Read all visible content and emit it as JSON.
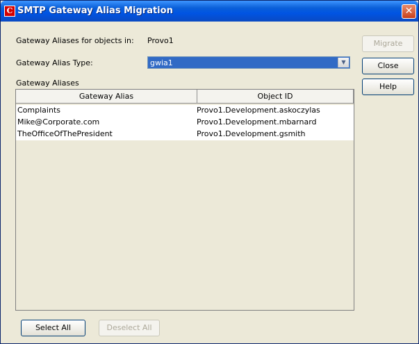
{
  "window": {
    "title": "SMTP Gateway Alias Migration"
  },
  "form": {
    "objects_label": "Gateway Aliases for objects in:",
    "objects_value": "Provo1",
    "type_label": "Gateway Alias Type:",
    "type_value": "gwia1",
    "list_label": "Gateway Aliases"
  },
  "table": {
    "columns": [
      "Gateway Alias",
      "Object ID"
    ],
    "rows": [
      [
        "Complaints",
        "Provo1.Development.askoczylas"
      ],
      [
        "Mike@Corporate.com",
        "Provo1.Development.mbarnard"
      ],
      [
        "TheOfficeOfThePresident",
        "Provo1.Development.gsmith"
      ]
    ]
  },
  "buttons": {
    "migrate": "Migrate",
    "close": "Close",
    "help": "Help",
    "select_all": "Select All",
    "deselect_all": "Deselect All"
  }
}
